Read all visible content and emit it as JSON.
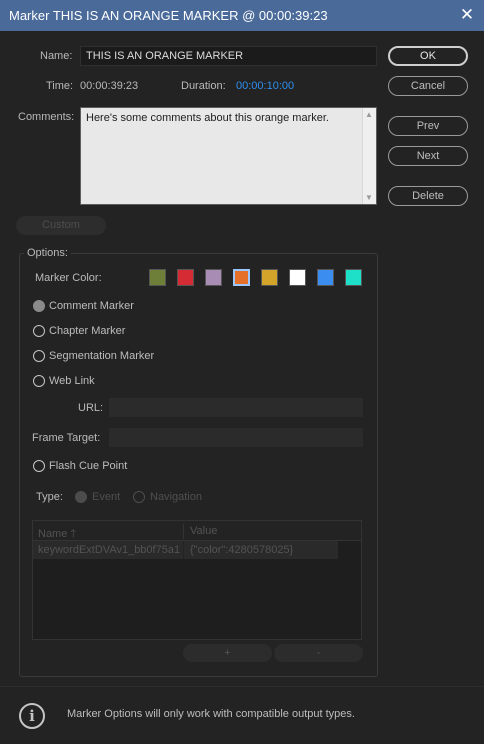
{
  "window": {
    "title": "Marker THIS IS AN ORANGE MARKER @ 00:00:39:23",
    "close_glyph": "✕"
  },
  "form": {
    "name_label": "Name:",
    "name_value": "THIS IS AN ORANGE MARKER",
    "time_label": "Time:",
    "time_value": "00:00:39:23",
    "duration_label": "Duration:",
    "duration_value": "00:00:10:00",
    "comments_label": "Comments:",
    "comments_value": "Here's some comments about this orange marker."
  },
  "buttons": {
    "ok": "OK",
    "cancel": "Cancel",
    "prev": "Prev",
    "next": "Next",
    "delete": "Delete",
    "custom": "Custom"
  },
  "options": {
    "legend": "Options:",
    "marker_color_label": "Marker Color:",
    "colors": [
      "#6e7f3a",
      "#d42b35",
      "#a98cb3",
      "#e5702a",
      "#d3a42a",
      "#ffffff",
      "#3b8ef0",
      "#1ee0c8"
    ],
    "selected_color_index": 3,
    "marker_types": [
      {
        "label": "Comment Marker",
        "checked": true
      },
      {
        "label": "Chapter Marker",
        "checked": false
      },
      {
        "label": "Segmentation Marker",
        "checked": false
      },
      {
        "label": "Web Link",
        "checked": false
      }
    ],
    "url_label": "URL:",
    "url_value": "",
    "frame_target_label": "Frame Target:",
    "frame_target_value": "",
    "flash_cue_label": "Flash Cue Point",
    "type_label": "Type:",
    "type_event": "Event",
    "type_navigation": "Navigation",
    "table": {
      "columns": [
        "Name",
        "Value"
      ],
      "sort_glyph": "🡑",
      "rows": [
        {
          "name": "keywordExtDVAv1_bb0f75a1",
          "value": "{\"color\":4280578025}"
        }
      ]
    },
    "add_button": "+",
    "remove_button": "-"
  },
  "footer": {
    "info_glyph": "i",
    "message": "Marker Options will only work with compatible output types."
  }
}
